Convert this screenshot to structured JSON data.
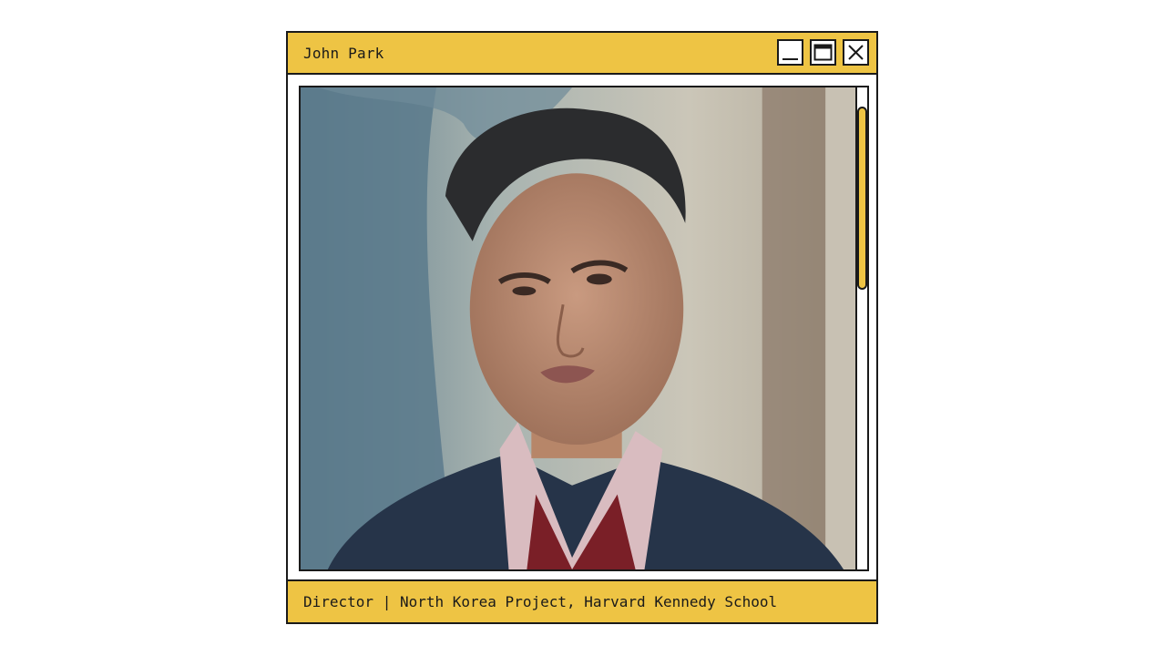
{
  "window": {
    "title": "John Park",
    "controls": {
      "minimize_icon": "minimize-icon",
      "maximize_icon": "maximize-icon",
      "close_icon": "close-icon"
    }
  },
  "media": {
    "subject": "video-frame"
  },
  "scrollbar": {
    "position_fraction": 0.04,
    "visible_fraction": 0.38
  },
  "caption": {
    "text": "Director | North Korea Project, Harvard Kennedy School"
  },
  "colors": {
    "accent": "#eec444",
    "border": "#1a1a1a",
    "background": "#ffffff"
  }
}
